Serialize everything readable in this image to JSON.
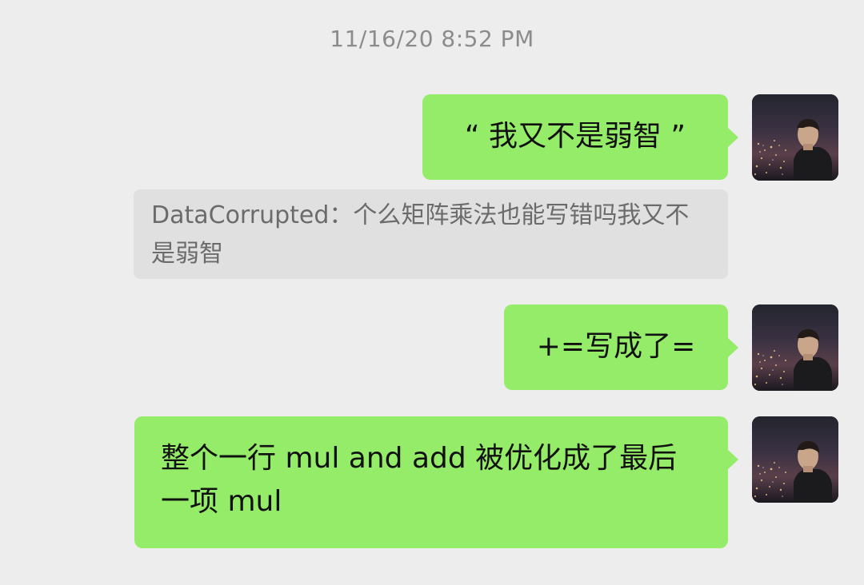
{
  "chat": {
    "timestamp": "11/16/20 8:52 PM",
    "messages": [
      {
        "sender": "self",
        "type": "text",
        "text": "“ 我又不是弱智 ”"
      },
      {
        "sender": "quote",
        "type": "quote",
        "author": "DataCorrupted",
        "separator": "：",
        "text": "个么矩阵乘法也能写错吗我又不是弱智"
      },
      {
        "sender": "self",
        "type": "text",
        "text": "+=写成了="
      },
      {
        "sender": "self",
        "type": "text",
        "text": "整个一行 mul and add 被优化成了最后一项 mul"
      }
    ]
  },
  "avatar": {
    "icon": "night-city-photo-avatar"
  },
  "colors": {
    "background": "#ededed",
    "self_bubble": "#95ec69",
    "quote_background": "#e0e0e0",
    "timestamp_text": "#8c8c8c",
    "quote_text": "#6b6b6b"
  }
}
